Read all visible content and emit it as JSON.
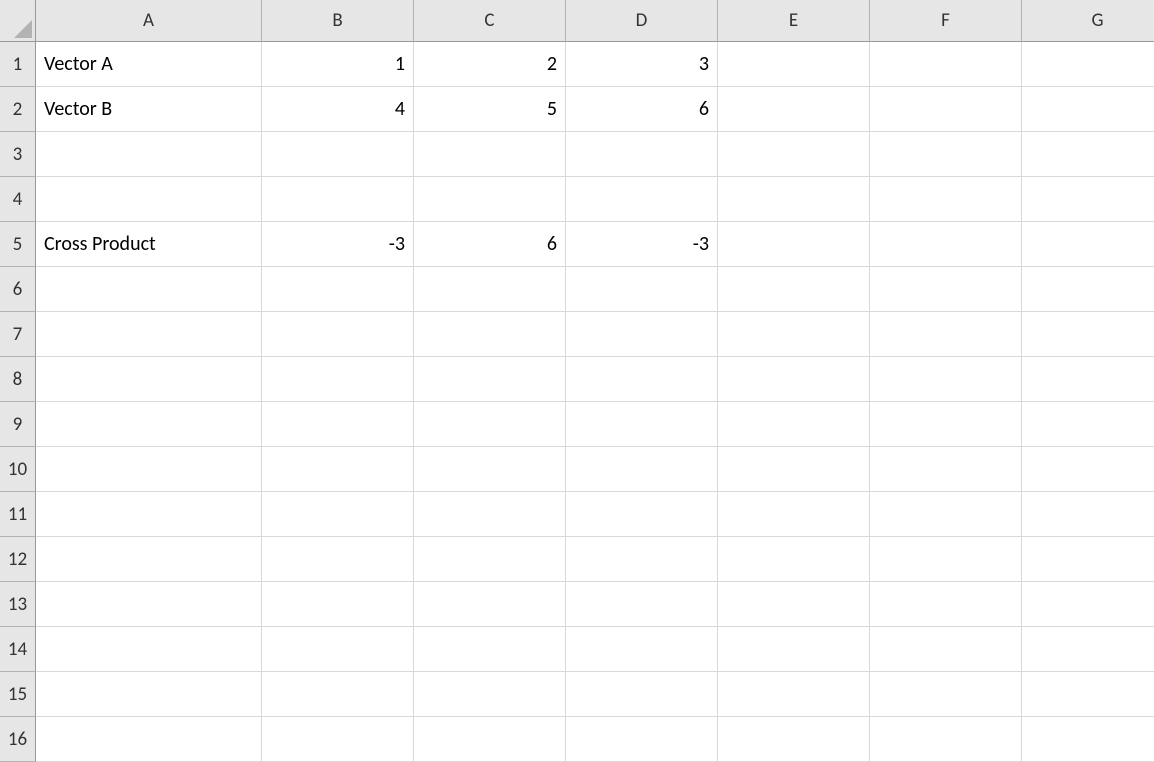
{
  "columns": [
    "A",
    "B",
    "C",
    "D",
    "E",
    "F",
    "G"
  ],
  "rows": [
    "1",
    "2",
    "3",
    "4",
    "5",
    "6",
    "7",
    "8",
    "9",
    "10",
    "11",
    "12",
    "13",
    "14",
    "15",
    "16"
  ],
  "cells": {
    "r1": {
      "A": {
        "value": "Vector A",
        "type": "text"
      },
      "B": {
        "value": "1",
        "type": "num"
      },
      "C": {
        "value": "2",
        "type": "num"
      },
      "D": {
        "value": "3",
        "type": "num"
      }
    },
    "r2": {
      "A": {
        "value": "Vector B",
        "type": "text"
      },
      "B": {
        "value": "4",
        "type": "num"
      },
      "C": {
        "value": "5",
        "type": "num"
      },
      "D": {
        "value": "6",
        "type": "num"
      }
    },
    "r5": {
      "A": {
        "value": "Cross Product",
        "type": "text"
      },
      "B": {
        "value": "-3",
        "type": "num"
      },
      "C": {
        "value": "6",
        "type": "num"
      },
      "D": {
        "value": "-3",
        "type": "num"
      }
    }
  }
}
